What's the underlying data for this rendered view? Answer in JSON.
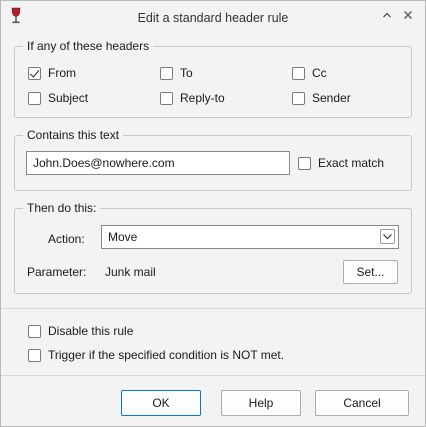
{
  "window": {
    "title": "Edit a standard header rule",
    "collapse_glyph": "^",
    "close_glyph": "×"
  },
  "headers_group": {
    "legend": "If any of these headers",
    "options": [
      {
        "label": "From",
        "checked": true
      },
      {
        "label": "To",
        "checked": false
      },
      {
        "label": "Cc",
        "checked": false
      },
      {
        "label": "Subject",
        "checked": false
      },
      {
        "label": "Reply-to",
        "checked": false
      },
      {
        "label": "Sender",
        "checked": false
      }
    ]
  },
  "contains_group": {
    "legend": "Contains this text",
    "text_value": "John.Does@nowhere.com",
    "exact_match_label": "Exact match",
    "exact_match_checked": false
  },
  "then_group": {
    "legend": "Then do this:",
    "action_label": "Action:",
    "action_value": "Move",
    "parameter_label": "Parameter:",
    "parameter_value": "Junk mail",
    "set_button": "Set..."
  },
  "options": {
    "disable_label": "Disable this rule",
    "disable_checked": false,
    "trigger_label": "Trigger if the specified condition is NOT met.",
    "trigger_checked": false
  },
  "buttons": {
    "ok": "OK",
    "help": "Help",
    "cancel": "Cancel"
  },
  "colors": {
    "accent": "#0078d7",
    "icon_red": "#b0202a"
  },
  "icons": {
    "app": "wine-glass-icon"
  }
}
